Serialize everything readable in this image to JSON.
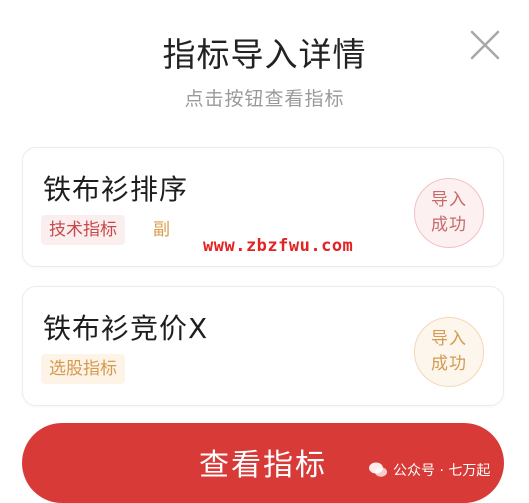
{
  "dialog": {
    "title": "指标导入详情",
    "subtitle": "点击按钮查看指标"
  },
  "cards": [
    {
      "title": "铁布衫排序",
      "tags": [
        "技术指标",
        "副"
      ],
      "status_line1": "导入",
      "status_line2": "成功"
    },
    {
      "title": "铁布衫竞价X",
      "tags": [
        "选股指标"
      ],
      "status_line1": "导入",
      "status_line2": "成功"
    }
  ],
  "watermark": "www.zbzfwu.com",
  "button": {
    "label": "查看指标"
  },
  "source": {
    "text": "公众号 · 七万起"
  },
  "colors": {
    "accent": "#d83a37",
    "tag_red": "#c8484a",
    "tag_orange": "#d49a4e",
    "watermark": "#e32222"
  }
}
